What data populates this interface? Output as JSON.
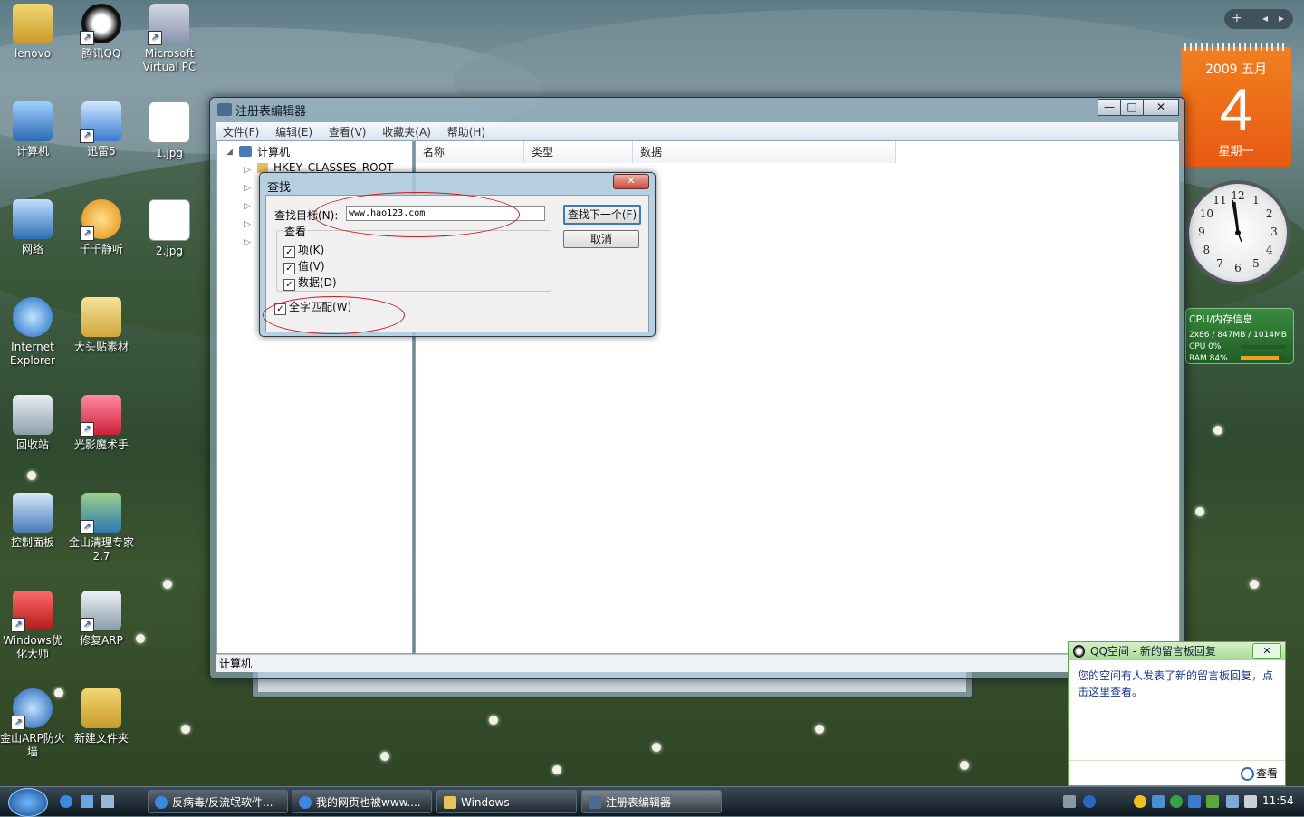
{
  "desktop": {
    "icons": [
      {
        "label": "lenovo"
      },
      {
        "label": "腾讯QQ"
      },
      {
        "label": "Microsoft Virtual PC"
      },
      {
        "label": "计算机"
      },
      {
        "label": "迅雷5"
      },
      {
        "label": "1.jpg"
      },
      {
        "label": "网络"
      },
      {
        "label": "千千静听"
      },
      {
        "label": "2.jpg"
      },
      {
        "label": "Internet Explorer"
      },
      {
        "label": "大头贴素材"
      },
      {
        "label": "回收站"
      },
      {
        "label": "光影魔术手"
      },
      {
        "label": "控制面板"
      },
      {
        "label": "金山清理专家 2.7"
      },
      {
        "label": "Windows优化大师"
      },
      {
        "label": "修复ARP"
      },
      {
        "label": "金山ARP防火墙"
      },
      {
        "label": "新建文件夹"
      }
    ]
  },
  "regedit": {
    "title": "注册表编辑器",
    "caption": {
      "minimize": "—",
      "maximize": "□",
      "close": "✕"
    },
    "menu": [
      "文件(F)",
      "编辑(E)",
      "查看(V)",
      "收藏夹(A)",
      "帮助(H)"
    ],
    "tree": {
      "root": "计算机",
      "first_key": "HKEY_CLASSES_ROOT"
    },
    "columns": [
      "名称",
      "类型",
      "数据"
    ],
    "status": "计算机"
  },
  "find_dialog": {
    "title": "查找",
    "close": "✕",
    "target_label": "查找目标(N):",
    "target_value": "www.hao123.com",
    "find_next": "查找下一个(F)",
    "cancel": "取消",
    "look_at_label": "查看",
    "options": [
      {
        "label": "项(K)",
        "checked": true
      },
      {
        "label": "值(V)",
        "checked": true
      },
      {
        "label": "数据(D)",
        "checked": true
      }
    ],
    "whole_word": {
      "label": "全字匹配(W)",
      "checked": true
    },
    "annotation_color": "#d01818"
  },
  "gadgets": {
    "calendar": {
      "month": "2009 五月",
      "day": "4",
      "weekday": "星期一"
    },
    "clock": {
      "numerals": [
        "12",
        "1",
        "2",
        "3",
        "4",
        "5",
        "6",
        "7",
        "8",
        "9",
        "10",
        "11"
      ]
    },
    "cpu": {
      "title": "CPU/内存信息",
      "line1": "2x86 / 847MB / 1014MB",
      "cpu": "CPU   0%",
      "ram": "RAM   84%"
    },
    "sidebar_controls": {
      "add": "+",
      "prev": "◂",
      "next": "▸"
    }
  },
  "qq_notify": {
    "title": "QQ空间 - 新的留言板回复",
    "close": "✕",
    "message": "您的空间有人发表了新的留言板回复，点击这里查看。",
    "view": "查看"
  },
  "taskbar": {
    "buttons": [
      {
        "label": "反病毒/反流氓软件..."
      },
      {
        "label": "我的网页也被www...."
      },
      {
        "label": "Windows"
      },
      {
        "label": "注册表编辑器"
      }
    ],
    "clock": "11:54"
  }
}
